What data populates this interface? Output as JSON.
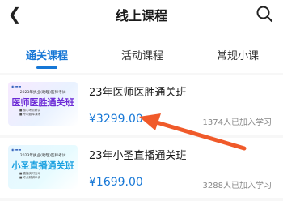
{
  "header": {
    "title": "线上课程",
    "back_icon": "chevron-left-icon",
    "search_icon": "search-icon"
  },
  "tabs": [
    {
      "label": "通关课程",
      "active": true
    },
    {
      "label": "活动课程",
      "active": false
    },
    {
      "label": "常规小课",
      "active": false
    }
  ],
  "courses": [
    {
      "name": "23年医师医胜通关班",
      "price": "¥3299.00",
      "students": "1374人已加入学习",
      "thumb": {
        "subtitle": "2023年执业(助理)医师考试",
        "big_title": "医师医胜通关班",
        "bullets": [
          "■ 核心考点精讲",
          "■ 专项题库演练"
        ]
      }
    },
    {
      "name": "23年小圣直播通关班",
      "price": "¥1699.00",
      "students": "3288人已加入学习",
      "thumb": {
        "subtitle": "2023年执业(助理)医师考试",
        "big_title": "小圣直播通关班",
        "bullets": [
          "■ 直播实时互动",
          "■ 考点精讲串讲"
        ]
      }
    }
  ],
  "colors": {
    "accent": "#1677d6",
    "arrow": "#f05a2a"
  }
}
